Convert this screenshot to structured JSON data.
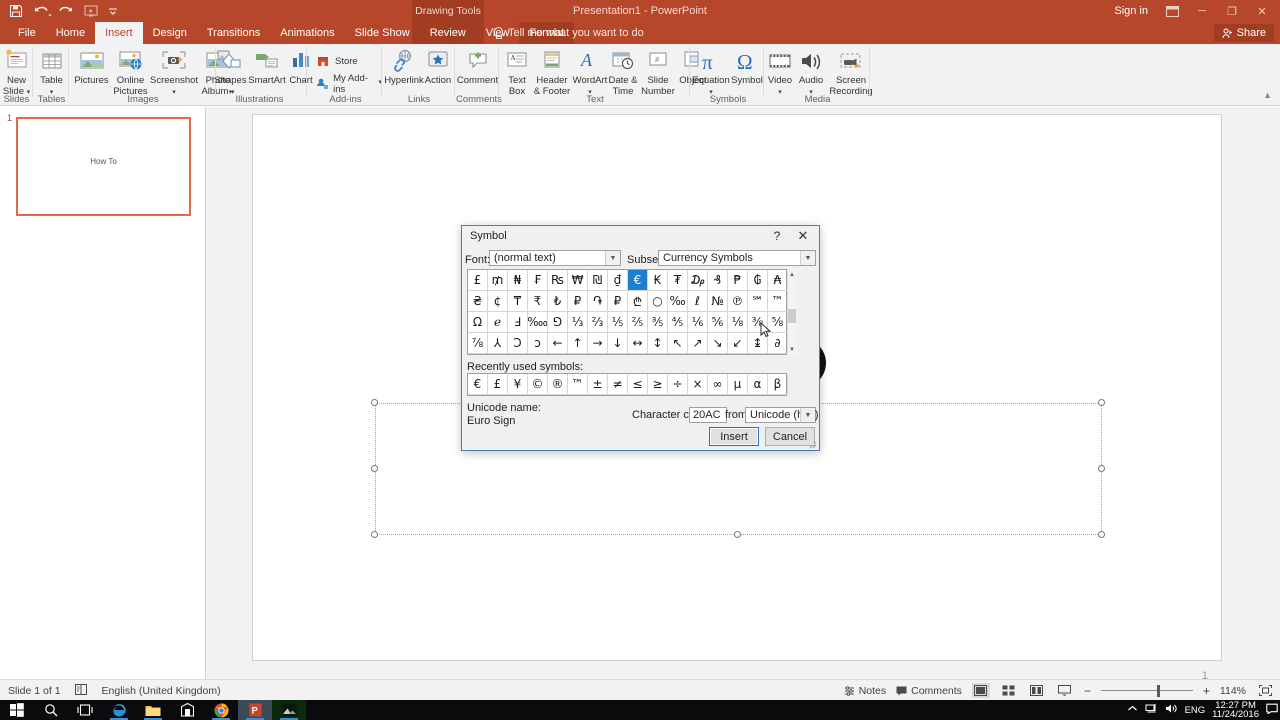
{
  "titlebar": {
    "app_title": "Presentation1 - PowerPoint",
    "sign_in": "Sign in",
    "quick_access": [
      "save-icon",
      "undo-icon",
      "redo-icon",
      "start-presentation-icon",
      "customize-qat-icon"
    ],
    "minimize": "─",
    "maximize": "❐",
    "close": "✕",
    "ribbon_display_icon": "ribbon-display-options-icon"
  },
  "tabs": {
    "items": [
      "File",
      "Home",
      "Insert",
      "Design",
      "Transitions",
      "Animations",
      "Slide Show",
      "Review",
      "View"
    ],
    "active": "Insert",
    "contextual_group": "Drawing Tools",
    "contextual_tab": "Format",
    "tell_me": "Tell me what you want to do",
    "share": "Share"
  },
  "ribbon": {
    "groups": [
      {
        "name": "Slides",
        "items": [
          {
            "label": "New\nSlide",
            "icon": "new-slide-icon",
            "dropdown": true
          }
        ]
      },
      {
        "name": "Tables",
        "items": [
          {
            "label": "Table",
            "icon": "table-icon",
            "dropdown": true
          }
        ]
      },
      {
        "name": "Images",
        "items": [
          {
            "label": "Pictures",
            "icon": "pictures-icon",
            "dropdown": false
          },
          {
            "label": "Online\nPictures",
            "icon": "online-pictures-icon",
            "dropdown": false
          },
          {
            "label": "Screenshot",
            "icon": "screenshot-icon",
            "dropdown": true
          },
          {
            "label": "Photo\nAlbum",
            "icon": "photo-album-icon",
            "dropdown": true
          }
        ]
      },
      {
        "name": "Illustrations",
        "items": [
          {
            "label": "Shapes",
            "icon": "shapes-icon",
            "dropdown": true
          },
          {
            "label": "SmartArt",
            "icon": "smartart-icon",
            "dropdown": false
          },
          {
            "label": "Chart",
            "icon": "chart-icon",
            "dropdown": false
          }
        ]
      },
      {
        "name": "Add-ins",
        "items": [
          {
            "label": "Store",
            "icon": "store-icon",
            "dropdown": false
          },
          {
            "label": "My Add-ins",
            "icon": "my-addins-icon",
            "dropdown": true
          }
        ]
      },
      {
        "name": "Links",
        "items": [
          {
            "label": "Hyperlink",
            "icon": "hyperlink-icon",
            "dropdown": false
          },
          {
            "label": "Action",
            "icon": "action-icon",
            "dropdown": false
          }
        ]
      },
      {
        "name": "Comments",
        "items": [
          {
            "label": "Comment",
            "icon": "comment-icon",
            "dropdown": false
          }
        ]
      },
      {
        "name": "Text",
        "items": [
          {
            "label": "Text\nBox",
            "icon": "text-box-icon",
            "dropdown": false
          },
          {
            "label": "Header\n& Footer",
            "icon": "header-footer-icon",
            "dropdown": false
          },
          {
            "label": "WordArt",
            "icon": "wordart-icon",
            "dropdown": true
          },
          {
            "label": "Date &\nTime",
            "icon": "date-time-icon",
            "dropdown": false
          },
          {
            "label": "Slide\nNumber",
            "icon": "slide-number-icon",
            "dropdown": false
          },
          {
            "label": "Object",
            "icon": "object-icon",
            "dropdown": false
          }
        ]
      },
      {
        "name": "Symbols",
        "items": [
          {
            "label": "Equation",
            "icon": "equation-icon",
            "dropdown": true
          },
          {
            "label": "Symbol",
            "icon": "symbol-icon",
            "dropdown": false
          }
        ]
      },
      {
        "name": "Media",
        "items": [
          {
            "label": "Video",
            "icon": "video-icon",
            "dropdown": true
          },
          {
            "label": "Audio",
            "icon": "audio-icon",
            "dropdown": true
          },
          {
            "label": "Screen\nRecording",
            "icon": "screen-recording-icon",
            "dropdown": false
          }
        ]
      }
    ],
    "collapse_icon": "collapse-ribbon-icon"
  },
  "slides_pane": {
    "slide_number": "1",
    "slide_title": "How To"
  },
  "canvas": {
    "slide_number_footer": "1"
  },
  "dialog": {
    "title": "Symbol",
    "help_label": "?",
    "close_label": "✕",
    "font_label": "Font:",
    "font_value": "(normal text)",
    "subset_label": "Subset:",
    "subset_value": "Currency Symbols",
    "grid": [
      "£",
      "₥",
      "₦",
      "₣",
      "₨",
      "₩",
      "₪",
      "₫",
      "€",
      "₭",
      "₮",
      "₯",
      "₰",
      "₱",
      "₲",
      "₳",
      "₴",
      "¢",
      "₸",
      "₹",
      "₺",
      "₽",
      "֏",
      "₽",
      "₾",
      "○",
      "‰",
      "ℓ",
      "№",
      "℗",
      "℠",
      "™",
      "Ω",
      "ℯ",
      "Ⅎ",
      "‱",
      "⅁",
      "⅓",
      "⅔",
      "⅕",
      "⅖",
      "⅗",
      "⅘",
      "⅙",
      "⅚",
      "⅛",
      "⅜",
      "⅝",
      "⅞",
      "⅄",
      "Ↄ",
      "ↄ",
      "←",
      "↑",
      "→",
      "↓",
      "↔",
      "↕",
      "↖",
      "↗",
      "↘",
      "↙",
      "↨",
      "∂"
    ],
    "selected_index": 8,
    "selected_symbol": "€",
    "recent_label": "Recently used symbols:",
    "recent": [
      "€",
      "£",
      "¥",
      "©",
      "®",
      "™",
      "±",
      "≠",
      "≤",
      "≥",
      "÷",
      "×",
      "∞",
      "μ",
      "α",
      "β"
    ],
    "unicode_label": "Unicode name:",
    "unicode_name": "Euro Sign",
    "charcode_label": "Character code:",
    "charcode_value": "20AC",
    "from_label": "from:",
    "from_value": "Unicode (hex)",
    "insert_label": "Insert",
    "cancel_label": "Cancel",
    "accent_color": "#1d7fd1"
  },
  "statusbar": {
    "slide_of": "Slide 1 of 1",
    "language": "English (United Kingdom)",
    "accessibility_icon": "accessibility-icon",
    "notes": "Notes",
    "comments": "Comments",
    "views": [
      "normal-view-icon",
      "slide-sorter-icon",
      "reading-view-icon",
      "slideshow-icon"
    ],
    "active_view": "normal-view-icon",
    "zoom_out": "−",
    "zoom_in": "+",
    "zoom_level": "114%",
    "fit_slide_icon": "fit-to-window-icon"
  },
  "taskbar": {
    "start_icon": "windows-start-icon",
    "search_icon": "search-icon",
    "taskview_icon": "task-view-icon",
    "apps": [
      "edge-icon",
      "file-explorer-icon",
      "store-icon",
      "chrome-icon",
      "powerpoint-icon",
      "photos-icon"
    ],
    "tray": [
      "show-hidden-icons-icon",
      "network-icon",
      "volume-icon"
    ],
    "language": "ENG",
    "time": "12:27 PM",
    "date": "11/24/2016",
    "action_center_icon": "action-center-icon"
  },
  "colors": {
    "powerpoint_orange": "#b7472a",
    "contextual_dark": "#a23d22",
    "dialog_accent": "#1d7fd1",
    "selection_border": "#e06a4c"
  }
}
